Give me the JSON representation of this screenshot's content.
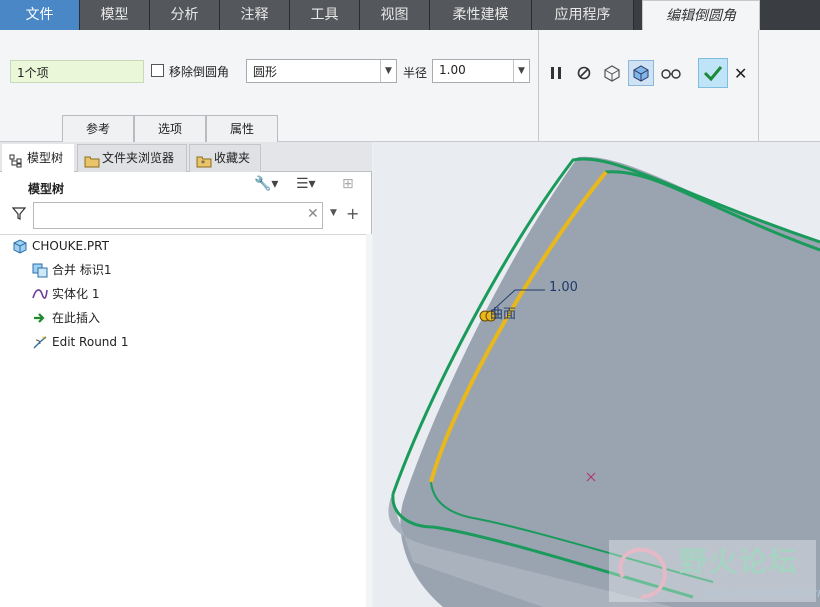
{
  "menu": {
    "file": "文件",
    "tabs": [
      "模型",
      "分析",
      "注释",
      "工具",
      "视图",
      "柔性建模",
      "应用程序"
    ],
    "active": "编辑倒圆角"
  },
  "ribbon": {
    "selection_value": "1个项",
    "remove_round_label": "移除倒圆角",
    "shape_value": "圆形",
    "radius_label": "半径",
    "radius_value": "1.00",
    "subtabs": [
      "参考",
      "选项",
      "属性"
    ],
    "icons": [
      "pause-icon",
      "no-preview-icon",
      "geometry-preview-icon",
      "attached-preview-icon",
      "verify-glasses-icon",
      "ok-check-icon",
      "cancel-x-icon"
    ]
  },
  "panel": {
    "tabs": [
      "模型树",
      "文件夹浏览器",
      "收藏夹"
    ],
    "tree_title": "模型树",
    "tree": [
      {
        "label": "CHOUKE.PRT",
        "icon": "part-icon"
      },
      {
        "label": "合并 标识1",
        "icon": "merge-icon"
      },
      {
        "label": "实体化 1",
        "icon": "solidify-icon"
      },
      {
        "label": "在此插入",
        "icon": "insert-here-arrow-icon"
      },
      {
        "label": "Edit Round 1",
        "icon": "edit-round-icon"
      }
    ]
  },
  "viewport": {
    "dimension_value": "1.00",
    "surface_label": "曲面",
    "watermark_title": "野火论坛",
    "watermark_url": "www.proewildfire.cn"
  },
  "colors": {
    "accent": "#4a87c6",
    "selection_green": "#eaf7d9",
    "model_gray": "#9aa4b1",
    "edge_green": "#1a9a5b",
    "highlight_yellow": "#e8b81c"
  }
}
